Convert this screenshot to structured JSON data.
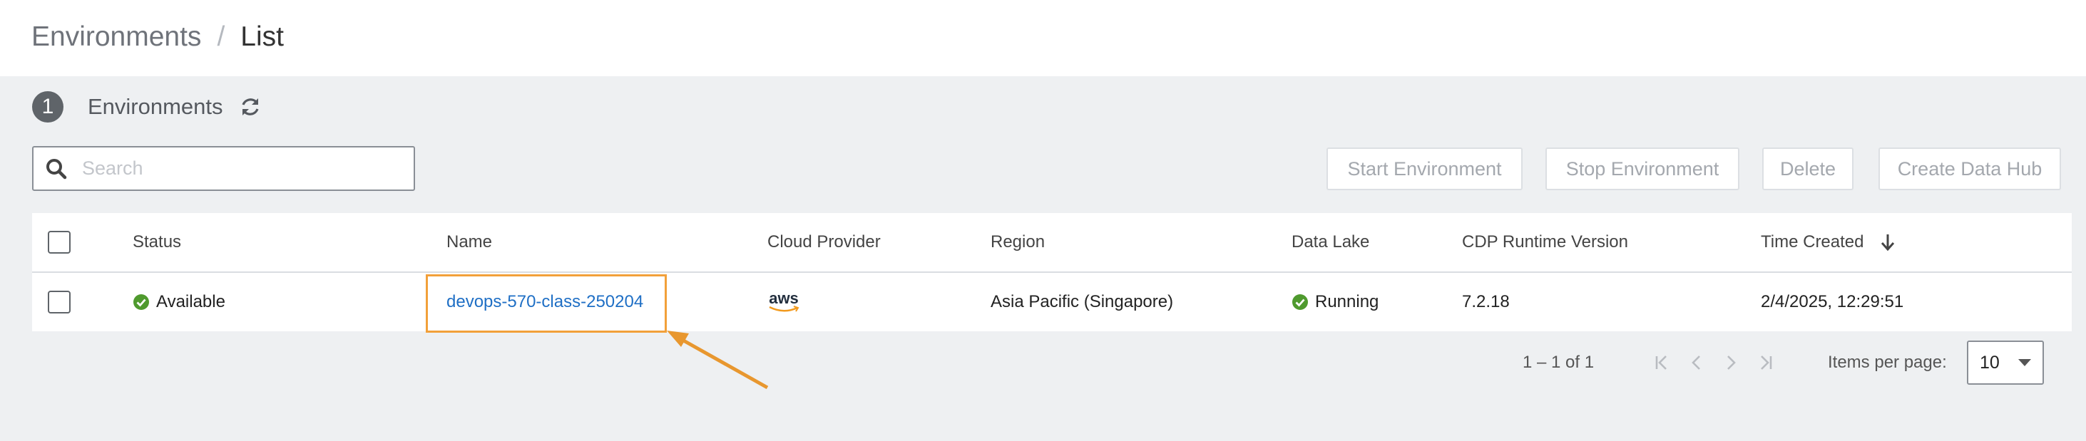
{
  "breadcrumb": {
    "root": "Environments",
    "separator": "/",
    "current": "List"
  },
  "summary": {
    "count": "1",
    "title": "Environments"
  },
  "search": {
    "placeholder": "Search",
    "value": ""
  },
  "actions": {
    "start": "Start Environment",
    "stop": "Stop Environment",
    "delete": "Delete",
    "create_data_hub": "Create Data Hub"
  },
  "table": {
    "columns": [
      "Status",
      "Name",
      "Cloud Provider",
      "Region",
      "Data Lake",
      "CDP Runtime Version",
      "Time Created"
    ],
    "sort": {
      "column": "Time Created",
      "direction": "descending"
    },
    "rows": [
      {
        "status": "Available",
        "name": "devops-570-class-250204",
        "cloud_provider": "aws",
        "region": "Asia Pacific (Singapore)",
        "data_lake": "Running",
        "runtime_version": "7.2.18",
        "time_created": "2/4/2025, 12:29:51"
      }
    ]
  },
  "pagination": {
    "range": "1 – 1 of 1",
    "items_per_page_label": "Items per page:",
    "items_per_page": "10"
  },
  "colors": {
    "success": "#4f9a2e",
    "link": "#1f6fc5",
    "highlight": "#f2a03a",
    "badge": "#5f6469"
  },
  "icons": [
    "refresh-icon",
    "search-icon",
    "check-circle-icon",
    "aws-logo",
    "arrow-down-icon",
    "first-page-icon",
    "prev-page-icon",
    "next-page-icon",
    "last-page-icon",
    "chevron-down-icon"
  ]
}
